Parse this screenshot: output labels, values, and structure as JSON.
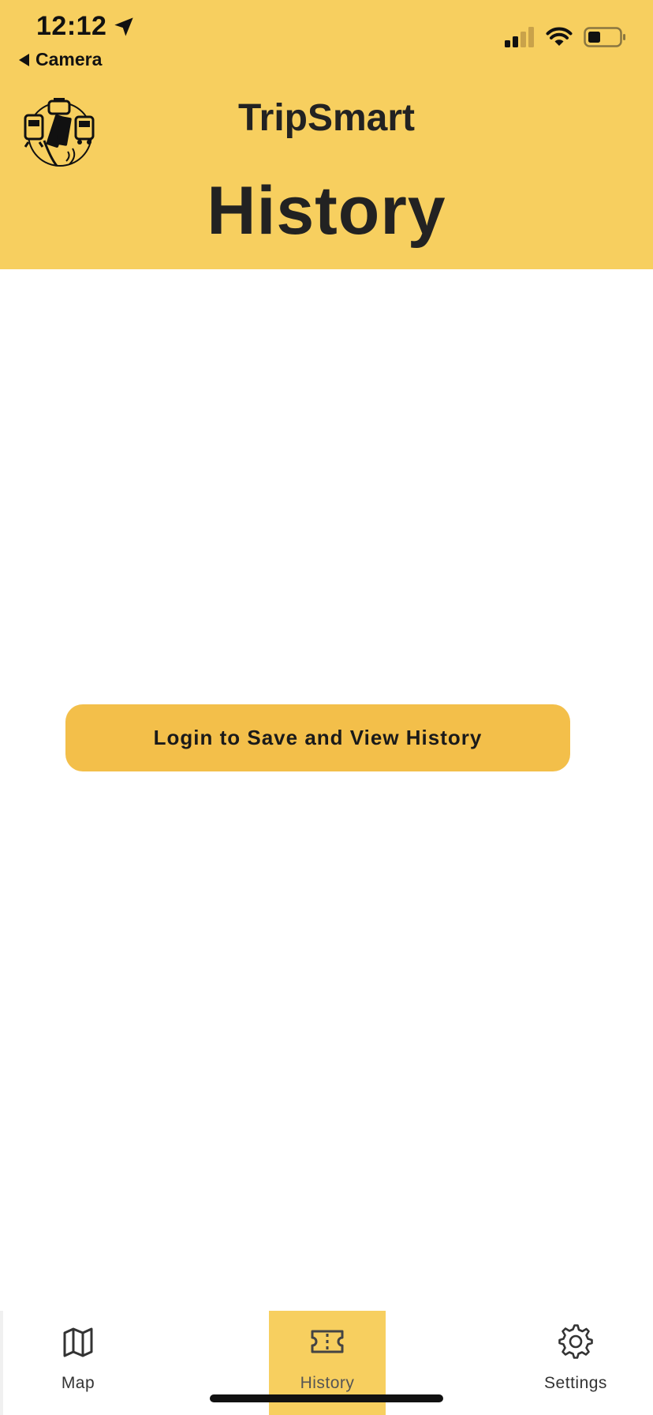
{
  "status_bar": {
    "time": "12:12",
    "back_label": "Camera"
  },
  "header": {
    "app_title": "TripSmart",
    "page_title": "History"
  },
  "main": {
    "login_button_label": "Login to Save and View History"
  },
  "tabbar": {
    "tabs": [
      {
        "label": "Map",
        "icon": "map-icon",
        "active": false
      },
      {
        "label": "History",
        "icon": "ticket-icon",
        "active": true
      },
      {
        "label": "Settings",
        "icon": "gear-icon",
        "active": false
      }
    ]
  },
  "colors": {
    "header_bg": "#f7cf5f",
    "button_bg": "#f3bf4a",
    "active_tab_bg": "#f7cf5f",
    "text": "#222222"
  }
}
